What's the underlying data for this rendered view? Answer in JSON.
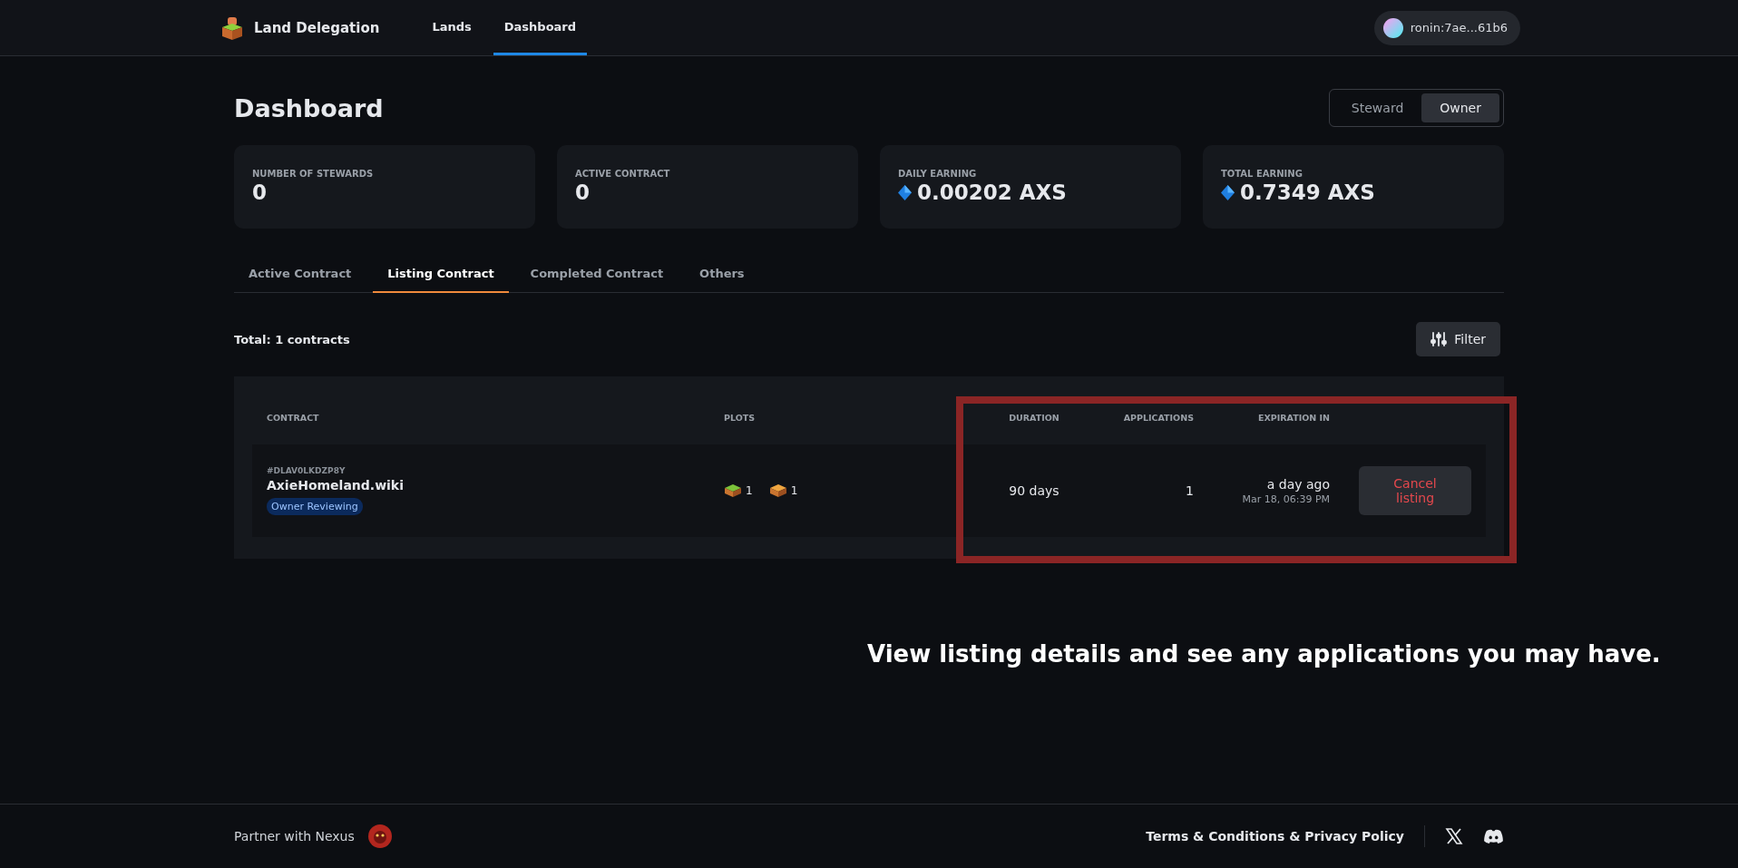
{
  "header": {
    "app_name": "Land Delegation",
    "nav": [
      {
        "label": "Lands",
        "selected": false
      },
      {
        "label": "Dashboard",
        "selected": true
      }
    ],
    "wallet": "ronin:7ae...61b6"
  },
  "page": {
    "title": "Dashboard",
    "roles": [
      {
        "label": "Steward",
        "selected": false
      },
      {
        "label": "Owner",
        "selected": true
      }
    ]
  },
  "stats": [
    {
      "label": "NUMBER OF STEWARDS",
      "value": "0",
      "kind": "count"
    },
    {
      "label": "ACTIVE CONTRACT",
      "value": "0",
      "kind": "count"
    },
    {
      "label": "DAILY EARNING",
      "value": "0.00202 AXS",
      "kind": "token"
    },
    {
      "label": "TOTAL EARNING",
      "value": "0.7349 AXS",
      "kind": "token"
    }
  ],
  "tabs": [
    {
      "label": "Active Contract",
      "selected": false
    },
    {
      "label": "Listing Contract",
      "selected": true
    },
    {
      "label": "Completed Contract",
      "selected": false
    },
    {
      "label": "Others",
      "selected": false
    }
  ],
  "total": "Total: 1 contracts",
  "filter_button": "Filter",
  "table": {
    "columns": [
      "CONTRACT",
      "PLOTS",
      "DURATION",
      "APPLICATIONS",
      "EXPIRATION IN"
    ],
    "rows": [
      {
        "id": "#DLAV0LKDZP8Y",
        "name": "AxieHomeland.wiki",
        "status": "Owner Reviewing",
        "plots": [
          {
            "kind": "grass",
            "count": "1"
          },
          {
            "kind": "sand",
            "count": "1"
          }
        ],
        "duration": "90 days",
        "applications": "1",
        "expiration": "a day ago",
        "expiration_date": "Mar 18, 06:39 PM",
        "action": "Cancel listing"
      }
    ]
  },
  "caption": "View listing details and see any applications you may have.",
  "footer": {
    "partner": "Partner with Nexus",
    "legal": "Terms & Conditions & Privacy Policy"
  }
}
